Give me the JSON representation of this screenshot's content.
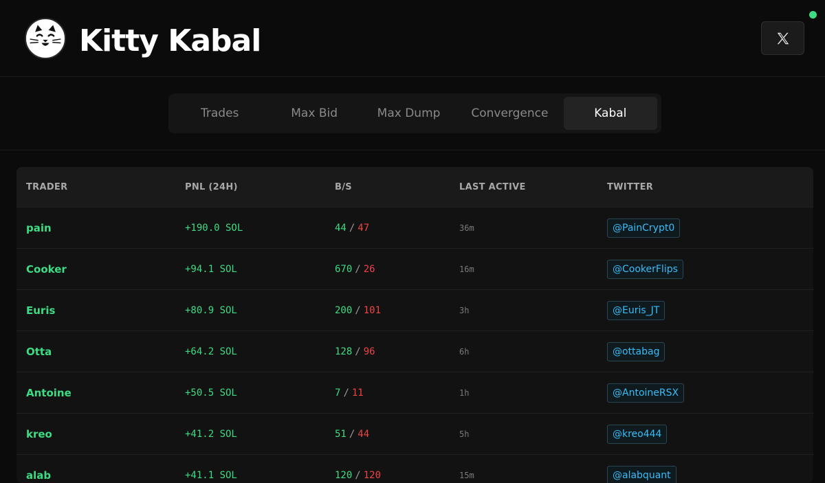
{
  "header": {
    "title": "Kitty Kabal",
    "logo_icon": "cat-face-icon",
    "x_button_icon": "x-logo-icon",
    "status_color": "#3ddc84"
  },
  "tabs": [
    {
      "label": "Trades",
      "active": false
    },
    {
      "label": "Max Bid",
      "active": false
    },
    {
      "label": "Max Dump",
      "active": false
    },
    {
      "label": "Convergence",
      "active": false
    },
    {
      "label": "Kabal",
      "active": true
    }
  ],
  "table": {
    "headers": {
      "trader": "TRADER",
      "pnl": "PNL (24H)",
      "bs": "B/S",
      "last_active": "LAST ACTIVE",
      "twitter": "TWITTER"
    },
    "rows": [
      {
        "trader": "pain",
        "pnl": "+190.0 SOL",
        "buys": "44",
        "sells": "47",
        "last_active": "36m",
        "twitter": "@PainCrypt0"
      },
      {
        "trader": "Cooker",
        "pnl": "+94.1 SOL",
        "buys": "670",
        "sells": "26",
        "last_active": "16m",
        "twitter": "@CookerFlips"
      },
      {
        "trader": "Euris",
        "pnl": "+80.9 SOL",
        "buys": "200",
        "sells": "101",
        "last_active": "3h",
        "twitter": "@Euris_JT"
      },
      {
        "trader": "Otta",
        "pnl": "+64.2 SOL",
        "buys": "128",
        "sells": "96",
        "last_active": "6h",
        "twitter": "@ottabag"
      },
      {
        "trader": "Antoine",
        "pnl": "+50.5 SOL",
        "buys": "7",
        "sells": "11",
        "last_active": "1h",
        "twitter": "@AntoineRSX"
      },
      {
        "trader": "kreo",
        "pnl": "+41.2 SOL",
        "buys": "51",
        "sells": "44",
        "last_active": "5h",
        "twitter": "@kreo444"
      },
      {
        "trader": "alab",
        "pnl": "+41.1 SOL",
        "buys": "120",
        "sells": "120",
        "last_active": "15m",
        "twitter": "@alabquant"
      }
    ],
    "separator": "/"
  },
  "colors": {
    "positive": "#3ddc84",
    "negative": "#ef4444",
    "link": "#38bdf8",
    "background": "#0b0b0b"
  }
}
